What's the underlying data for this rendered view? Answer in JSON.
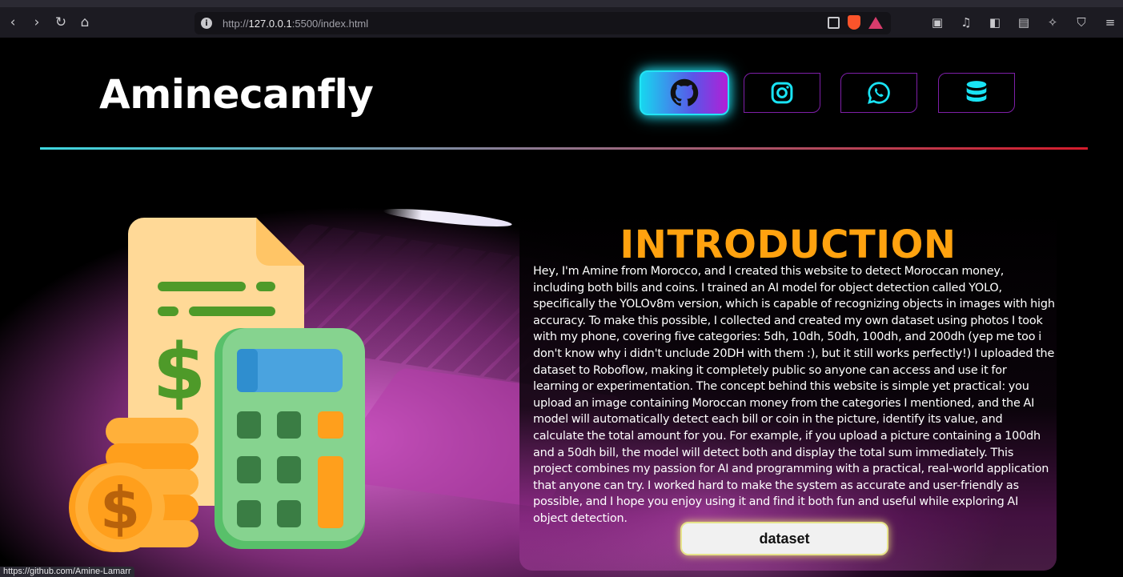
{
  "browser": {
    "url_scheme": "http://",
    "url_host": "127.0.0.1",
    "url_rest": ":5500/index.html",
    "status_link": "https://github.com/Amine-Lamarr"
  },
  "header": {
    "brand": "Aminecanfly",
    "social": [
      {
        "name": "github",
        "icon": "github-icon"
      },
      {
        "name": "instagram",
        "icon": "instagram-icon"
      },
      {
        "name": "whatsapp",
        "icon": "whatsapp-icon"
      },
      {
        "name": "database",
        "icon": "database-icon"
      }
    ],
    "divider_colors": [
      "#3ed8e0",
      "#d51c2c"
    ]
  },
  "intro": {
    "title": "INTRODUCTION",
    "body": "Hey, I'm Amine from Morocco, and I created this website to detect Moroccan money, including both bills and coins. I trained an AI model for object detection called YOLO, specifically the YOLOv8m version, which is capable of recognizing objects in images with high accuracy. To make this possible, I collected and created my own dataset using photos I took with my phone, covering five categories: 5dh, 10dh, 50dh, 100dh, and 200dh (yep me too i don't know why i didn't unclude 20DH with them :), but it still works perfectly!) I uploaded the dataset to Roboflow, making it completely public so anyone can access and use it for learning or experimentation. The concept behind this website is simple yet practical: you upload an image containing Moroccan money from the categories I mentioned, and the AI model will automatically detect each bill or coin in the picture, identify its value, and calculate the total amount for you. For example, if you upload a picture containing a 100dh and a 50dh bill, the model will detect both and display the total sum immediately. This project combines my passion for AI and programming with a practical, real-world application that anyone can try. I worked hard to make the system as accurate and user-friendly as possible, and I hope you enjoy using it and find it both fun and useful while exploring AI object detection.",
    "button": "dataset"
  },
  "colors": {
    "title_orange": "#ffa20f",
    "glow_cyan": "#22e4f5",
    "button_glow": "#e6e38a"
  }
}
